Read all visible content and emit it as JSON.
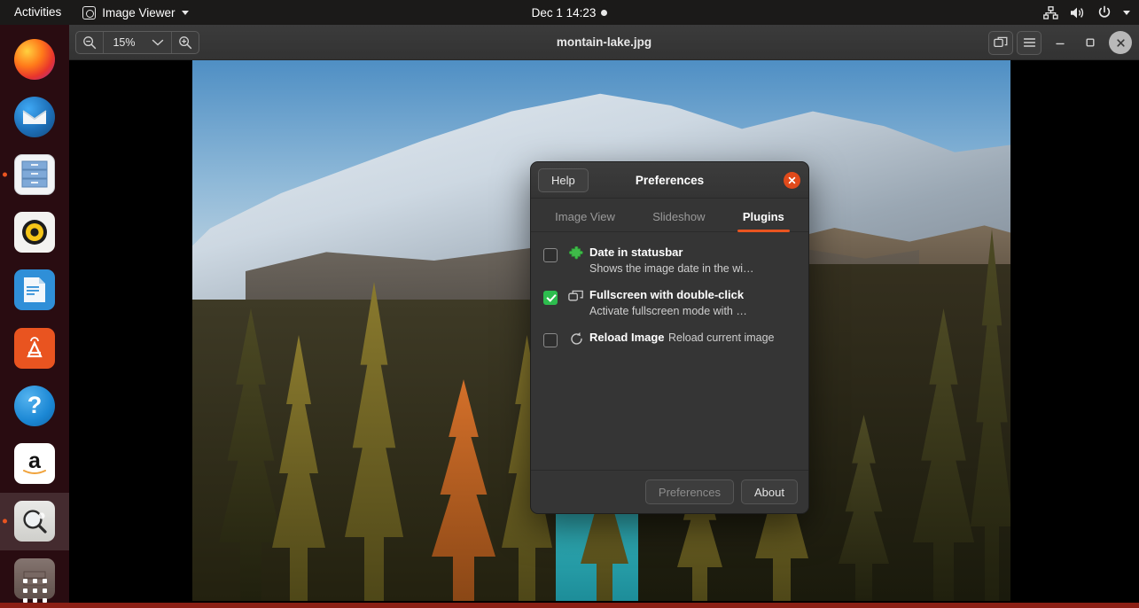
{
  "topbar": {
    "activities": "Activities",
    "app_menu": {
      "label": "Image Viewer",
      "icon": "image-viewer-icon",
      "caret": "chevron-down-icon"
    },
    "clock": "Dec 1  14:23",
    "tray": [
      {
        "name": "network-icon"
      },
      {
        "name": "volume-icon"
      },
      {
        "name": "power-icon"
      },
      {
        "name": "chevron-down-icon"
      }
    ]
  },
  "dock": {
    "items": [
      {
        "name": "firefox",
        "label": "Firefox",
        "running": false
      },
      {
        "name": "thunderbird",
        "label": "Thunderbird",
        "running": false
      },
      {
        "name": "files",
        "label": "Files",
        "running": true
      },
      {
        "name": "rhythmbox",
        "label": "Rhythmbox",
        "running": false
      },
      {
        "name": "libreoffice-writer",
        "label": "LibreOffice Writer",
        "running": false
      },
      {
        "name": "ubuntu-software",
        "label": "Ubuntu Software",
        "running": false
      },
      {
        "name": "help",
        "label": "Help",
        "running": false
      },
      {
        "name": "amazon",
        "label": "Amazon",
        "running": false
      },
      {
        "name": "image-viewer",
        "label": "Image Viewer",
        "running": true,
        "active": true
      },
      {
        "name": "trash",
        "label": "Trash",
        "running": false
      }
    ],
    "apps_grid_label": "Show Applications"
  },
  "window": {
    "title": "montain-lake.jpg",
    "zoom": {
      "level": "15%",
      "zoom_out_icon": "zoom-out-icon",
      "zoom_in_icon": "zoom-in-icon",
      "dropdown_icon": "chevron-down-icon"
    },
    "buttons": {
      "gallery_label": "Gallery",
      "menu_label": "Main Menu",
      "minimize_label": "–",
      "maximize_label": "□",
      "close_label": "✕"
    }
  },
  "dialog": {
    "help_label": "Help",
    "title": "Preferences",
    "close_label": "✕",
    "tabs": [
      {
        "label": "Image View",
        "active": false
      },
      {
        "label": "Slideshow",
        "active": false
      },
      {
        "label": "Plugins",
        "active": true
      }
    ],
    "plugins": [
      {
        "checked": false,
        "icon": "puzzle-piece-icon",
        "name": "Date in statusbar",
        "description": "Shows the image date in the wi…"
      },
      {
        "checked": true,
        "icon": "fullscreen-windows-icon",
        "name": "Fullscreen with double-click",
        "description": "Activate fullscreen mode with …"
      },
      {
        "checked": false,
        "icon": "reload-icon",
        "name": "Reload Image",
        "description": "Reload current image"
      }
    ],
    "footer": {
      "preferences_label": "Preferences",
      "about_label": "About"
    }
  },
  "colors": {
    "accent_orange": "#e95420",
    "dialog_bg": "#353535",
    "titlebar_bg": "#383838",
    "topbar_bg": "#1b1a19",
    "dock_bg": "#2c0d12",
    "check_green": "#2dbd4e",
    "bottom_strip": "#8b1f15"
  }
}
